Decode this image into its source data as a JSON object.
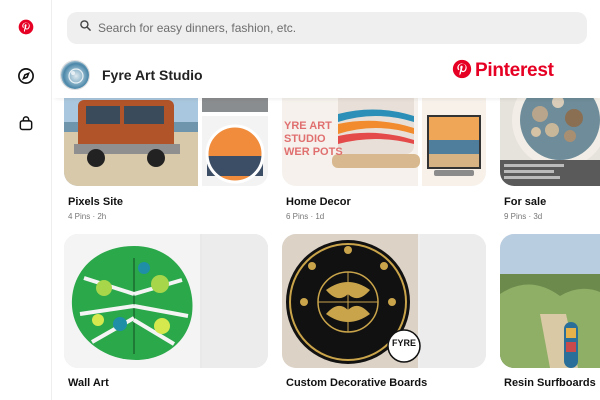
{
  "search": {
    "placeholder": "Search for easy dinners, fashion, etc."
  },
  "nav": {
    "items": [
      {
        "name": "pinterest-logo-icon"
      },
      {
        "name": "compass-icon"
      },
      {
        "name": "bag-icon"
      }
    ]
  },
  "profile": {
    "name": "Fyre Art Studio"
  },
  "brand": {
    "name": "Pinterest",
    "color": "#e60023"
  },
  "boards": [
    {
      "title": "Pixels Site",
      "meta": "4 Pins · 2h"
    },
    {
      "title": "Home Decor",
      "meta": "6 Pins · 1d",
      "cover_text": "YRE ART\nSTUDIO\nWER POTS"
    },
    {
      "title": "For sale",
      "meta": "9 Pins · 3d"
    },
    {
      "title": "Wall Art"
    },
    {
      "title": "Custom Decorative Boards",
      "cover_text": "FYRE"
    },
    {
      "title": "Resin Surfboards"
    }
  ]
}
